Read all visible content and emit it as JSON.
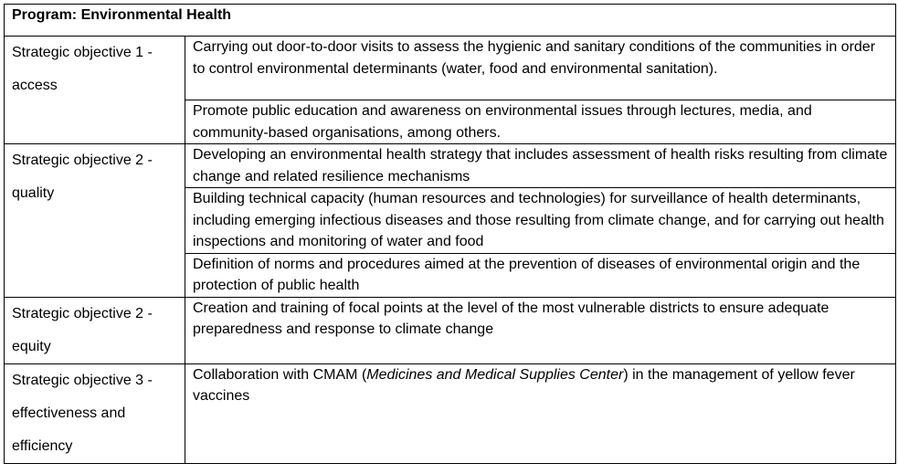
{
  "table": {
    "title": "Program: Environmental Health",
    "objectives": [
      {
        "label_lines": [
          "Strategic objective 1 -",
          "access"
        ],
        "actions": [
          "Carrying out door-to-door visits to assess the hygienic and sanitary conditions of the communities in order to control environmental determinants (water, food and environmental sanitation).",
          "Promote public education and awareness on environmental issues through lectures, media, and community-based organisations, among others."
        ]
      },
      {
        "label_lines": [
          "Strategic objective 2 -",
          "quality"
        ],
        "actions": [
          "Developing an environmental health strategy that includes assessment of health risks resulting from climate change and related resilience mechanisms",
          "Building technical capacity (human resources and technologies) for surveillance of health determinants, including emerging infectious diseases and those resulting from climate change, and for carrying out health inspections and monitoring of water and food",
          "Definition of norms and procedures aimed at the prevention of diseases of environmental origin and the protection of public health"
        ]
      },
      {
        "label_lines": [
          "Strategic objective 2 -",
          "equity"
        ],
        "actions": [
          "Creation and training of focal points at the level of the most vulnerable districts to ensure adequate preparedness and response to climate change"
        ]
      },
      {
        "label_lines": [
          "Strategic objective 3 -",
          "effectiveness and",
          "efficiency"
        ],
        "action_parts": {
          "before": "Collaboration with CMAM (",
          "italic": "Medicines and Medical Supplies Center",
          "after": ") in the management of yellow fever vaccines"
        }
      }
    ]
  }
}
